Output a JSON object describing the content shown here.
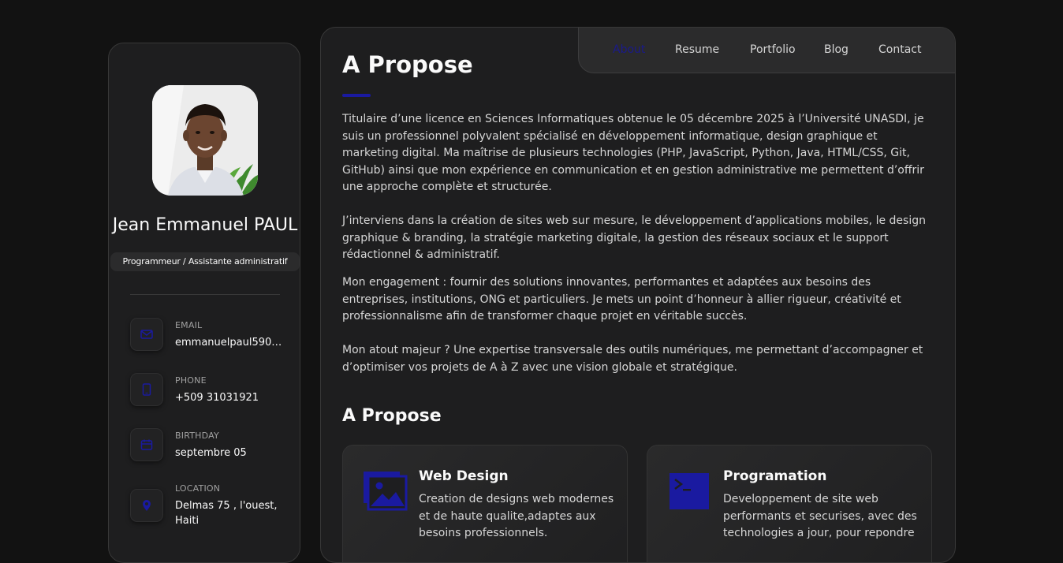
{
  "sidebar": {
    "name": "Jean Emmanuel PAUL",
    "title": "Programmeur / Assistante administratif",
    "contacts": [
      {
        "icon": "mail-icon",
        "label": "EMAIL",
        "value": "emmanuelpaul5902..."
      },
      {
        "icon": "phone-icon",
        "label": "PHONE",
        "value": "+509 31031921"
      },
      {
        "icon": "calendar-icon",
        "label": "BIRTHDAY",
        "value": "septembre 05"
      },
      {
        "icon": "location-icon",
        "label": "LOCATION",
        "value": "Delmas 75 , l'ouest, Haiti"
      }
    ]
  },
  "nav": {
    "items": [
      "About",
      "Resume",
      "Portfolio",
      "Blog",
      "Contact"
    ],
    "active": "About"
  },
  "about": {
    "heading": "A Propose",
    "paragraphs": [
      "Titulaire d’une licence en Sciences Informatiques obtenue le 05 décembre 2025 à l’Université UNASDI, je suis un professionnel polyvalent spécialisé en développement informatique, design graphique et marketing digital. Ma maîtrise de plusieurs technologies (PHP, JavaScript, Python, Java, HTML/CSS, Git, GitHub) ainsi que mon expérience en communication et en gestion administrative me permettent d’offrir une approche complète et structurée.",
      "J’interviens dans la création de sites web sur mesure, le développement d’applications mobiles, le design graphique & branding, la stratégie marketing digitale, la gestion des réseaux sociaux et le support rédactionnel & administratif.",
      "Mon engagement : fournir des solutions innovantes, performantes et adaptées aux besoins des entreprises, institutions, ONG et particuliers. Je mets un point d’honneur à allier rigueur, créativité et professionnalisme afin de transformer chaque projet en véritable succès.",
      "Mon atout majeur ? Une expertise transversale des outils numériques, me permettant d’accompagner et d’optimiser vos projets de A à Z avec une vision globale et stratégique."
    ]
  },
  "services": {
    "heading": "A Propose",
    "items": [
      {
        "icon": "image-icon",
        "title": "Web Design",
        "text": "Creation de designs web modernes et de haute qualite,adaptes aux besoins professionnels."
      },
      {
        "icon": "terminal-icon",
        "title": "Programation",
        "text": "Developpement de site web performants et securises, avec des technologies a jour, pour repondre"
      }
    ]
  },
  "colors": {
    "accent": "#1a1aa0",
    "background": "#121212",
    "card": "#1e1e1f"
  }
}
